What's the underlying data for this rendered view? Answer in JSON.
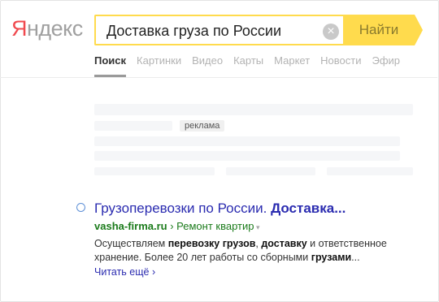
{
  "logo": {
    "first": "Я",
    "rest": "ндекс"
  },
  "search": {
    "query": "Доставка груза по России",
    "clear_icon": "×",
    "button_label": "Найти"
  },
  "tabs": [
    {
      "label": "Поиск",
      "active": true
    },
    {
      "label": "Картинки"
    },
    {
      "label": "Видео"
    },
    {
      "label": "Карты"
    },
    {
      "label": "Маркет"
    },
    {
      "label": "Новости"
    },
    {
      "label": "Эфир"
    }
  ],
  "ad": {
    "badge": "реклама"
  },
  "result": {
    "title_plain": "Грузоперевозки по России. ",
    "title_bold": "Доставка...",
    "domain": "vasha-firma.ru",
    "path_sep": " › ",
    "path": "Ремонт квартир",
    "path_marker": " ▾",
    "snippet": {
      "p1": "Осуществляем ",
      "b1": "перевозку грузов",
      "p2": ", ",
      "b2": "доставку",
      "p3": " и ответственное хранение. Более 20 лет работы со сборными ",
      "b3": "грузами",
      "p4": "..."
    },
    "read_more": "Читать ещё ›"
  }
}
